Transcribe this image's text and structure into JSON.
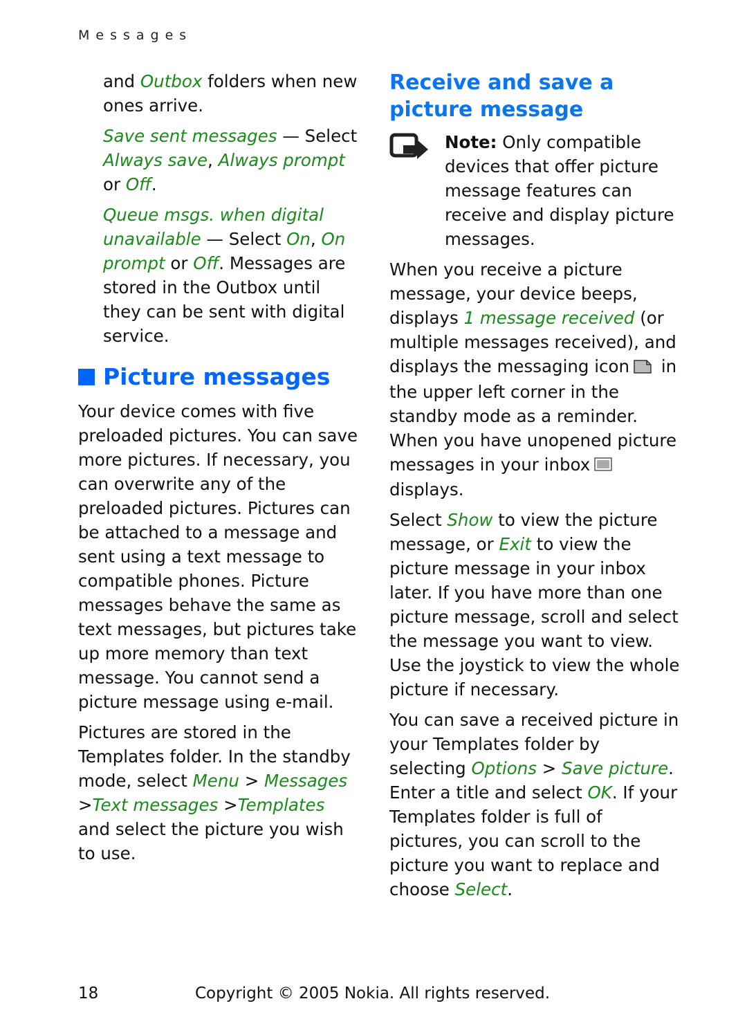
{
  "running_head": "Messages",
  "left_column": {
    "continuation": {
      "pre": "and ",
      "link": "Outbox",
      "post": " folders when new ones arrive."
    },
    "save_sent": {
      "term": "Save sent messages",
      "dash": " — Select ",
      "opt1": "Always save",
      "sep": ", ",
      "opt2": "Always prompt",
      "or": " or ",
      "opt3": "Off",
      "end": "."
    },
    "queue_msgs": {
      "term": "Queue msgs. when digital unavailable",
      "dash": " — Select ",
      "opt1": "On",
      "sep": ", ",
      "opt2": "On prompt",
      "or": " or ",
      "opt3": "Off",
      "rest": ". Messages are stored in the Outbox until they can be sent with digital service."
    },
    "section_heading": "Picture messages",
    "para1": "Your device comes with five preloaded pictures. You can save more pictures. If necessary, you can overwrite any of the preloaded pictures. Pictures can be attached to a message and sent using a text message to compatible phones. Picture messages behave the same as text messages, but pictures take up more memory than text message. You cannot send a picture message using e-mail.",
    "para2": {
      "pre": "Pictures are stored in the Templates folder. In the standby mode, select ",
      "path1": "Menu",
      "gt1": " > ",
      "path2": "Messages",
      "gt2": " >",
      "path3": "Text messages",
      "gt3": " >",
      "path4": "Templates",
      "post": " and select the picture you wish to use."
    }
  },
  "right_column": {
    "subheading": "Receive and save a picture message",
    "note": {
      "label": "Note:",
      "text": " Only compatible devices that offer picture message features can receive and display picture messages.",
      "icon": "note-arrow-icon"
    },
    "para1": {
      "pre": "When you receive a picture message, your device beeps, displays ",
      "link": "1 message received",
      "mid": " (or multiple messages received), and displays the messaging icon",
      "after_icon": " in the upper left corner in the standby mode as a reminder. When you have unopened picture messages in your inbox",
      "end": " displays.",
      "icon1": "messaging-icon",
      "icon2": "inbox-picture-icon"
    },
    "para2": {
      "pre": "Select ",
      "link1": "Show",
      "mid": " to view the picture message, or ",
      "link2": "Exit",
      "post": " to view the picture message in your inbox later. If you have more than one picture message, scroll and select the message you want to view. Use the joystick to view the whole picture if necessary."
    },
    "para3": {
      "pre": "You can save a received picture in your Templates folder by selecting ",
      "link1": "Options",
      "gt": " > ",
      "link2": "Save picture",
      "mid": ". Enter a title and select ",
      "link3": "OK",
      "post": ". If your Templates folder is full of pictures, you can scroll to the picture you want to replace and choose ",
      "link4": "Select",
      "end": "."
    }
  },
  "footer": {
    "page_number": "18",
    "copyright": "Copyright © 2005 Nokia. All rights reserved."
  },
  "colors": {
    "heading_blue": "#0066ff",
    "link_green": "#1a8a1a",
    "text": "#111111"
  }
}
